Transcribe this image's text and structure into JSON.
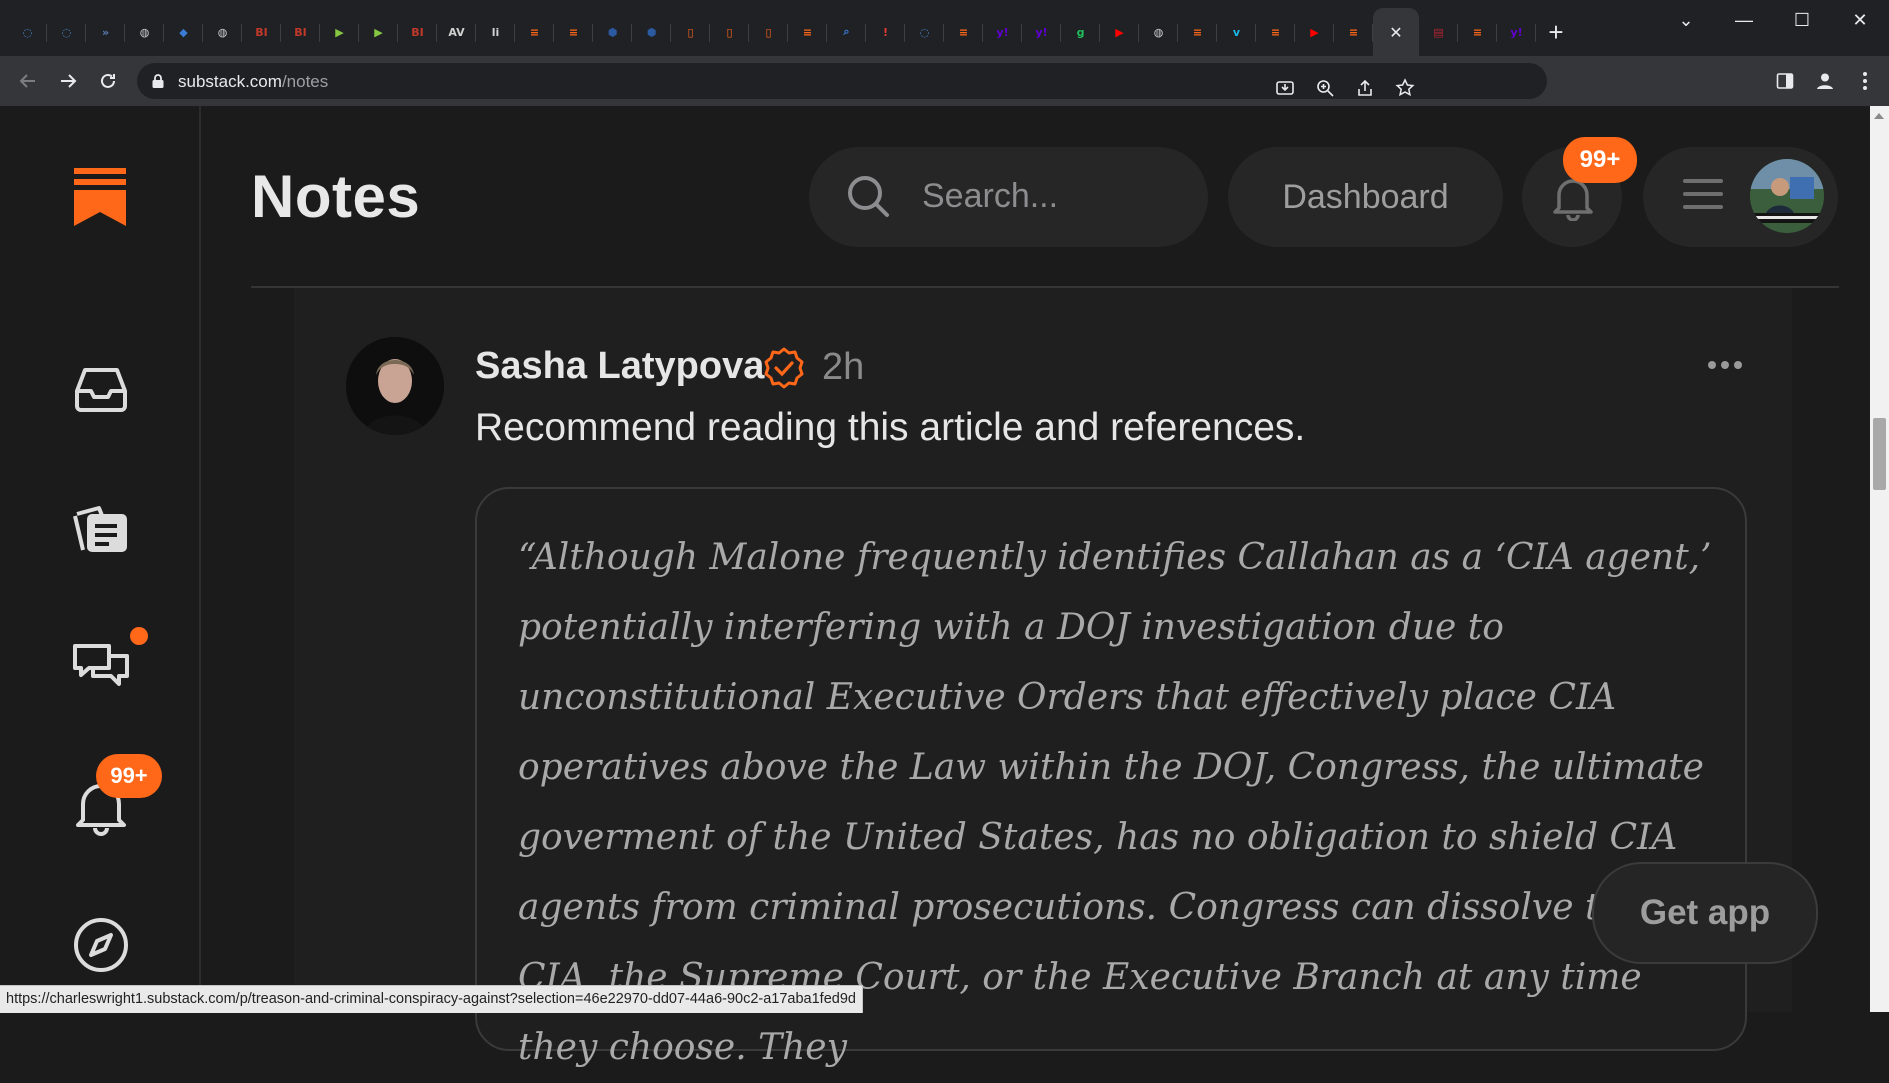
{
  "browser": {
    "tabs": [
      {
        "icon": "shield-icon",
        "color": "#4a90d9",
        "glyph": "◌"
      },
      {
        "icon": "shield-icon",
        "color": "#4a90d9",
        "glyph": "◌"
      },
      {
        "icon": "chevron-icon",
        "color": "#5b7fb8",
        "glyph": "»"
      },
      {
        "icon": "globe-icon",
        "color": "#cfcfcf",
        "glyph": "◍"
      },
      {
        "icon": "diamond-icon",
        "color": "#3a7bd5",
        "glyph": "◆"
      },
      {
        "icon": "globe-icon",
        "color": "#cfcfcf",
        "glyph": "◍"
      },
      {
        "icon": "bi-icon",
        "color": "#c0392b",
        "glyph": "BI"
      },
      {
        "icon": "bi-icon",
        "color": "#c0392b",
        "glyph": "BI"
      },
      {
        "icon": "rumble-icon",
        "color": "#85c742",
        "glyph": "▶"
      },
      {
        "icon": "rumble-icon",
        "color": "#85c742",
        "glyph": "▶"
      },
      {
        "icon": "bi-icon",
        "color": "#c0392b",
        "glyph": "BI"
      },
      {
        "icon": "news-icon",
        "color": "#d0d0d0",
        "glyph": "AV"
      },
      {
        "icon": "news-icon",
        "color": "#d0d0d0",
        "glyph": "li"
      },
      {
        "icon": "substack-icon",
        "color": "#ff6719",
        "glyph": "≡"
      },
      {
        "icon": "substack-icon",
        "color": "#ff6719",
        "glyph": "≡"
      },
      {
        "icon": "cube-icon",
        "color": "#2c5aa0",
        "glyph": "⬢"
      },
      {
        "icon": "cube-icon",
        "color": "#2c5aa0",
        "glyph": "⬢"
      },
      {
        "icon": "bookmark-icon",
        "color": "#ff6719",
        "glyph": "▯"
      },
      {
        "icon": "bookmark-icon",
        "color": "#ff6719",
        "glyph": "▯"
      },
      {
        "icon": "bookmark-icon",
        "color": "#ff6719",
        "glyph": "▯"
      },
      {
        "icon": "substack-icon",
        "color": "#ff6719",
        "glyph": "≡"
      },
      {
        "icon": "search-icon",
        "color": "#3a7bd5",
        "glyph": "⌕"
      },
      {
        "icon": "pin-icon",
        "color": "#e53935",
        "glyph": "!"
      },
      {
        "icon": "shield-icon",
        "color": "#4a90d9",
        "glyph": "◌"
      },
      {
        "icon": "substack-icon",
        "color": "#ff6719",
        "glyph": "≡"
      },
      {
        "icon": "yahoo-icon",
        "color": "#6001d2",
        "glyph": "y!"
      },
      {
        "icon": "yahoo-icon",
        "color": "#6001d2",
        "glyph": "y!"
      },
      {
        "icon": "g-icon",
        "color": "#1fbf5b",
        "glyph": "g"
      },
      {
        "icon": "youtube-icon",
        "color": "#ff0000",
        "glyph": "▶"
      },
      {
        "icon": "globe-icon",
        "color": "#cfcfcf",
        "glyph": "◍"
      },
      {
        "icon": "substack-icon",
        "color": "#ff6719",
        "glyph": "≡"
      },
      {
        "icon": "vimeo-icon",
        "color": "#1ab7ea",
        "glyph": "v"
      },
      {
        "icon": "substack-icon",
        "color": "#ff6719",
        "glyph": "≡"
      },
      {
        "icon": "youtube-icon",
        "color": "#ff0000",
        "glyph": "▶"
      },
      {
        "icon": "substack-icon",
        "color": "#ff6719",
        "glyph": "≡"
      }
    ],
    "active_tab_icon": "close-icon",
    "tabs_after": [
      {
        "icon": "flag-icon",
        "color": "#b22234",
        "glyph": "▤"
      },
      {
        "icon": "substack-icon",
        "color": "#ff6719",
        "glyph": "≡"
      },
      {
        "icon": "yahoo-icon",
        "color": "#6001d2",
        "glyph": "y!"
      }
    ],
    "url_host": "substack.com",
    "url_path": "/notes",
    "status_url": "https://charleswright1.substack.com/p/treason-and-criminal-conspiracy-against?selection=46e22970-dd07-44a6-90c2-a17aba1fed9d"
  },
  "header": {
    "title": "Notes",
    "search_placeholder": "Search...",
    "dashboard_label": "Dashboard",
    "notifications_badge": "99+"
  },
  "sidebar": {
    "items": [
      {
        "name": "inbox-icon"
      },
      {
        "name": "library-icon"
      },
      {
        "name": "chat-icon",
        "has_dot": true
      },
      {
        "name": "bell-icon",
        "badge": "99+"
      },
      {
        "name": "compass-icon"
      }
    ],
    "notifications_badge": "99+"
  },
  "post": {
    "author": "Sasha Latypova",
    "time": "2h",
    "text": "Recommend reading this article and references.",
    "quote": "“Although Malone frequently identifies Callahan as a ‘CIA agent,’ potentially interfering with a DOJ investigation due to unconstitutional Executive Orders that effectively place CIA operatives above the Law within the DOJ, Congress, the ultimate goverment of the United States, has no obligation to shield CIA agents from criminal prosecutions. Congress can dissolve the CIA, the Supreme Court, or the Executive Branch at any time they choose. They"
  },
  "get_app_label": "Get app",
  "colors": {
    "accent": "#ff6719",
    "background": "#1b1b1c",
    "pill": "#262627"
  }
}
